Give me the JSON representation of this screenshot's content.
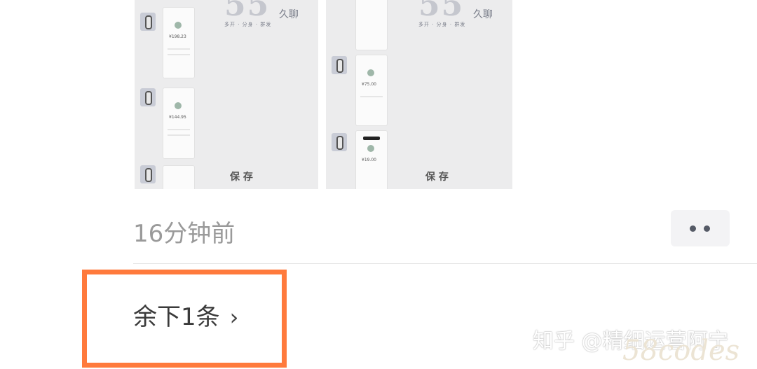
{
  "post": {
    "image_left": {
      "phone_amounts": [
        "¥198.23",
        "¥144.95"
      ],
      "watermark_big": "55",
      "watermark_small": "久聊",
      "watermark_sub": "多开 · 分身 · 群发",
      "footer_text": "保 存"
    },
    "image_right": {
      "phone_amounts": [
        "¥75.00",
        "¥19.00"
      ],
      "watermark_big": "55",
      "watermark_small": "久聊",
      "watermark_sub": "多开 · 分身 · 群发",
      "footer_text": "保 存"
    },
    "timestamp": "16分钟前",
    "more_icon": "more-dots-icon"
  },
  "comments": {
    "remaining_label": "余下1条",
    "chevron": "›",
    "highlight_color": "#ff7a3c"
  },
  "watermark": {
    "text": "知乎 @精细运营阿宁",
    "logo": "58codes"
  }
}
